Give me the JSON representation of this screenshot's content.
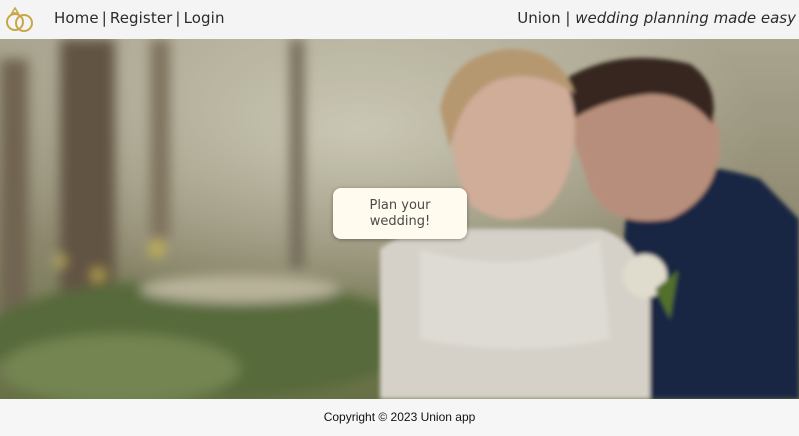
{
  "header": {
    "logo_icon": "wedding-rings-icon",
    "nav": {
      "home": "Home",
      "register": "Register",
      "login": "Login",
      "separator": "|"
    },
    "brand": {
      "name": "Union",
      "separator": "|",
      "tagline": "wedding planning made easy"
    }
  },
  "hero": {
    "cta_label": "Plan your wedding!"
  },
  "footer": {
    "copyright": "Copyright © 2023 Union app"
  },
  "colors": {
    "header_bg": "#f4f4f4",
    "logo_gold": "#c9a648",
    "cta_bg": "#fffbef",
    "footer_bg": "#f6f6f6"
  }
}
